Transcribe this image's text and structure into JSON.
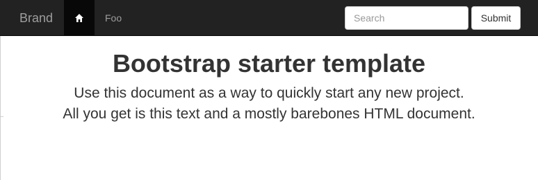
{
  "navbar": {
    "brand": "Brand",
    "home_icon": "home-icon",
    "items": [
      {
        "label": "Foo"
      }
    ],
    "search": {
      "placeholder": "Search",
      "value": ""
    },
    "submit_label": "Submit"
  },
  "main": {
    "title": "Bootstrap starter template",
    "lead_lines": [
      "Use this document as a way to quickly start any new project.",
      "All you get is this text and a mostly barebones HTML document."
    ]
  },
  "colors": {
    "navbar_bg": "#222222",
    "active_item_bg": "#080808",
    "nav_text": "#9d9d9d",
    "body_text": "#333333"
  }
}
